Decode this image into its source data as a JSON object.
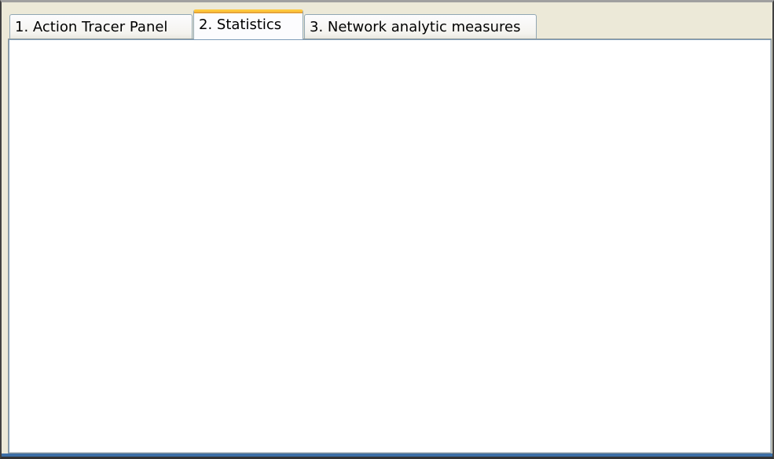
{
  "tabs": [
    {
      "label": "1. Action Tracer Panel",
      "selected": false
    },
    {
      "label": "2. Statistics",
      "selected": true
    },
    {
      "label": "3. Network analytic measures",
      "selected": false
    }
  ],
  "colors": {
    "window_background": "#ece9d8",
    "panel_background": "#ffffff",
    "active_tab_accent": "#ffc83c",
    "tab_border": "#91a7b4"
  }
}
